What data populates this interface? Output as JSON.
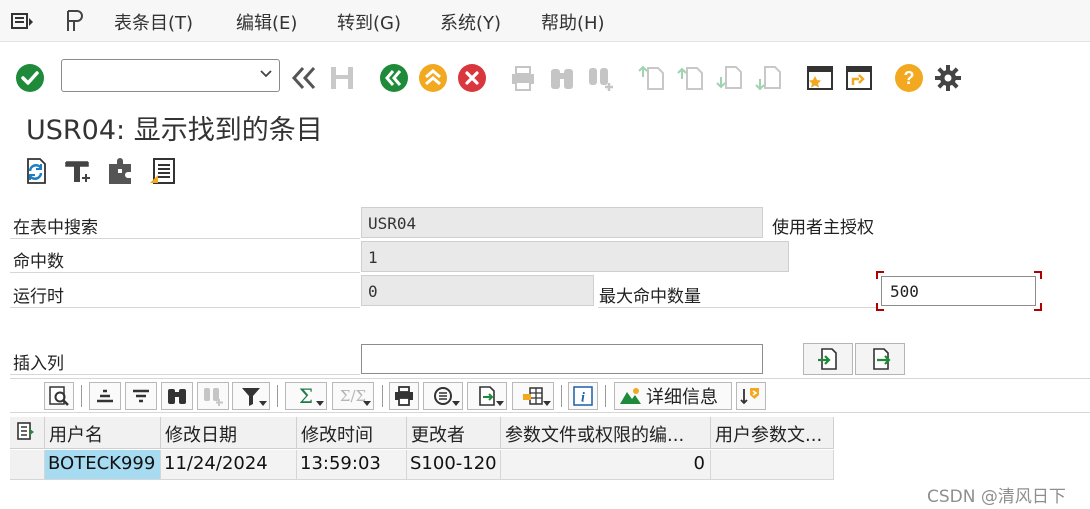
{
  "menu": {
    "items": [
      {
        "label": "表条目(T)"
      },
      {
        "label": "编辑(E)"
      },
      {
        "label": "转到(G)"
      },
      {
        "label": "系统(Y)"
      },
      {
        "label": "帮助(H)"
      }
    ]
  },
  "toolbar": {
    "command_field": {
      "value": "",
      "placeholder": ""
    }
  },
  "title": "USR04: 显示找到的条目",
  "selection": {
    "search_table_label": "在表中搜索",
    "search_table_value": "USR04",
    "search_table_desc": "使用者主授权",
    "hits_label": "命中数",
    "hits_value": "1",
    "runtime_label": "运行时",
    "runtime_value": "0",
    "max_hits_label": "最大命中数量",
    "max_hits_value": "500",
    "insert_col_label": "插入列",
    "insert_col_value": ""
  },
  "alv_toolbar": {
    "details_label": "详细信息"
  },
  "grid": {
    "columns": [
      "用户名",
      "修改日期",
      "修改时间",
      "更改者",
      "参数文件或权限的编...",
      "用户参数文..."
    ],
    "rows": [
      [
        "BOTECK999",
        "11/24/2024",
        "13:59:03",
        "S100-120",
        "0",
        ""
      ]
    ]
  },
  "watermark": "CSDN @清风日下",
  "colors": {
    "accent_green": "#1e8a3a",
    "accent_yellow": "#f2a91f",
    "accent_red": "#d9363e",
    "selected_cell": "#a7dbf1",
    "focus_marker": "#b00000"
  }
}
